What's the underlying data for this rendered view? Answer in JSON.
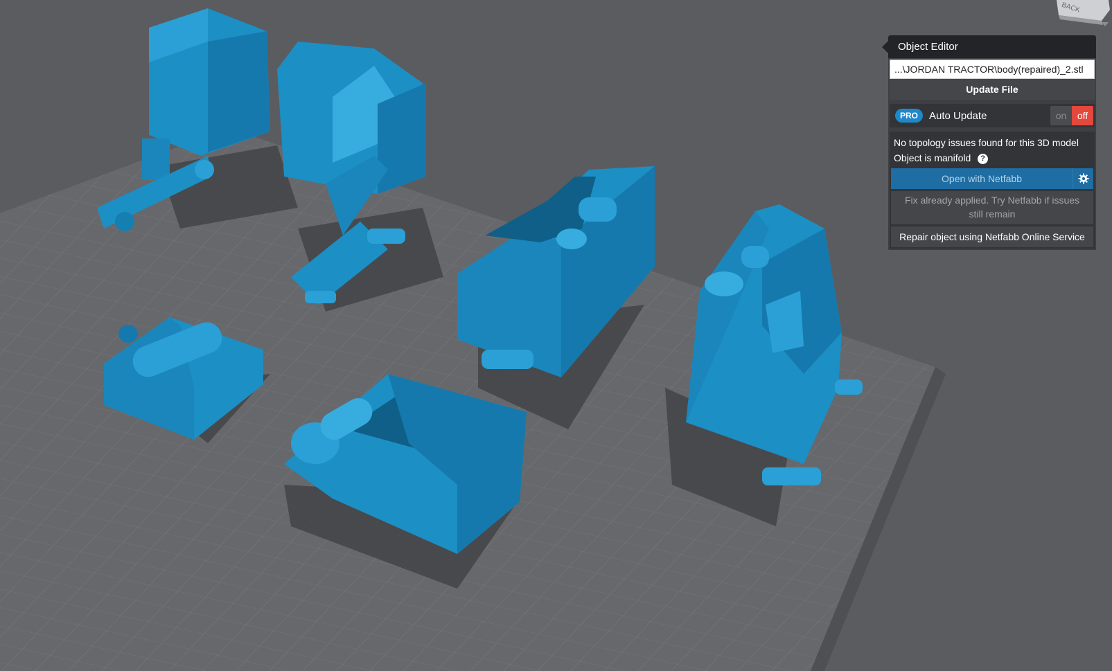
{
  "editor": {
    "title": "Object Editor",
    "file_path": "...\\JORDAN TRACTOR\\body(repaired)_2.stl",
    "update_label": "Update File",
    "pro_badge": "PRO",
    "auto_update_label": "Auto Update",
    "toggle_on": "on",
    "toggle_off": "off",
    "auto_update_state": "off",
    "topology_status": "No topology issues found for this 3D model",
    "manifold_status": "Object is manifold",
    "help_glyph": "?",
    "netfabb_label": "Open with Netfabb",
    "fix_note": "Fix already applied. Try Netfabb if issues still remain",
    "repair_label": "Repair object using Netfabb Online Service"
  },
  "view_cube": {
    "face_label": "BACK"
  },
  "icons": {
    "settings": "gear-icon",
    "help": "help-icon",
    "panel_pointer": "caret-left-icon"
  },
  "colors": {
    "model_blue": "#1c8fc4",
    "model_shadow": "#0f5f88",
    "viewport_bg": "#5b5c60",
    "build_plate": "#696a6e",
    "toggle_off": "#e4473c",
    "accent_blue": "#1e6da3"
  }
}
